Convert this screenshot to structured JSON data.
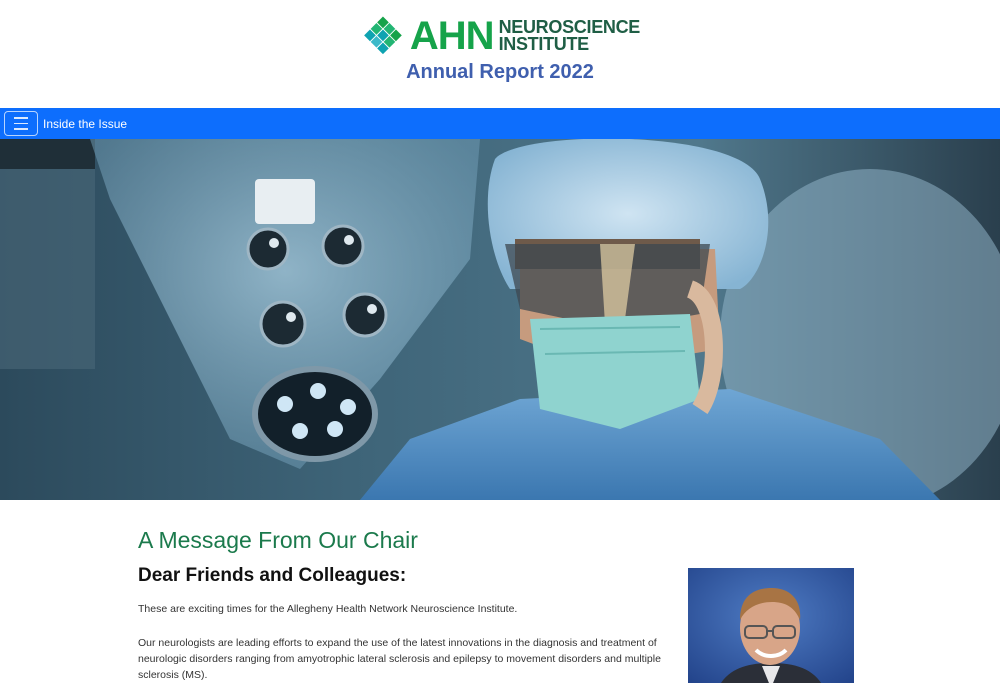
{
  "header": {
    "logo": {
      "brand": "AHN",
      "line1": "NEUROSCIENCE",
      "line2": "INSTITUTE",
      "mark_colors": [
        "#16a34a",
        "#22b573",
        "#0fa3b1",
        "#3bb9c9"
      ]
    },
    "report_title": "Annual Report 2022"
  },
  "nav": {
    "menu_icon": "hamburger-menu-icon",
    "label": "Inside the Issue",
    "background": "#0d6efd"
  },
  "hero": {
    "icon": "surgeon-with-microscope-photo"
  },
  "article": {
    "title": "A Message From Our Chair",
    "greeting": "Dear Friends and Colleagues:",
    "paragraphs": [
      "These are exciting times for the Allegheny Health Network Neuroscience Institute.",
      "Our neurologists are leading efforts to expand the use of the latest innovations in the diagnosis and treatment of neurologic disorders ranging from amyotrophic lateral sclerosis and epilepsy to movement disorders and multiple sclerosis (MS)."
    ],
    "portrait_icon": "chair-portrait-photo"
  },
  "colors": {
    "title_green": "#1b7a4c",
    "report_blue": "#3f5fae",
    "brand_green": "#16a34a"
  }
}
